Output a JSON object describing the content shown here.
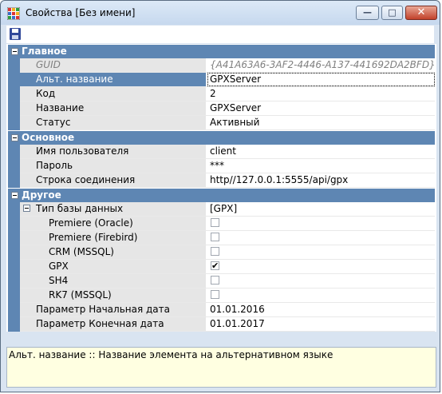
{
  "window": {
    "title": "Свойства [Без имени]"
  },
  "icons": {
    "app": "app-table-icon",
    "save": "save-icon",
    "minimize": "minimize-icon",
    "maximize": "maximize-icon",
    "close": "close-icon"
  },
  "glyphs": {
    "minimize": "—",
    "maximize": "□",
    "close": "✕"
  },
  "colors": {
    "category_bar": "#5e86b3",
    "selected_name": "#5e86b3",
    "name_cell": "#e6e6e6",
    "description_bg": "#ffffe1"
  },
  "grid": {
    "categories": [
      {
        "label": "Главное",
        "rows": [
          {
            "name": "GUID",
            "value": "{A41A63A6-3AF2-4446-A137-441692DA2BFD}",
            "readonly": true
          },
          {
            "name": "Альт. название",
            "value": "GPXServer",
            "selected": true
          },
          {
            "name": "Код",
            "value": "2"
          },
          {
            "name": "Название",
            "value": "GPXServer"
          },
          {
            "name": "Статус",
            "value": "Активный"
          }
        ]
      },
      {
        "label": "Основное",
        "rows": [
          {
            "name": "Имя пользователя",
            "value": "client"
          },
          {
            "name": "Пароль",
            "value": "***"
          },
          {
            "name": "Строка соединения",
            "value": "http//127.0.0.1:5555/api/gpx"
          }
        ]
      },
      {
        "label": "Другое",
        "rows": [
          {
            "name": "Тип базы данных",
            "value": "[GPX]",
            "expanded": true
          },
          {
            "name": "Premiere (Oracle)",
            "checked": false
          },
          {
            "name": "Premiere (Firebird)",
            "checked": false
          },
          {
            "name": "CRM (MSSQL)",
            "checked": false
          },
          {
            "name": "GPX",
            "checked": true
          },
          {
            "name": "SH4",
            "checked": false
          },
          {
            "name": "RK7 (MSSQL)",
            "checked": false
          },
          {
            "name": "Параметр Начальная дата",
            "value": "01.01.2016"
          },
          {
            "name": "Параметр Конечная дата",
            "value": "01.01.2017"
          }
        ]
      }
    ]
  },
  "description": {
    "text": "Альт. название :: Название элемента на альтернативном языке"
  },
  "check_glyph": "✔"
}
